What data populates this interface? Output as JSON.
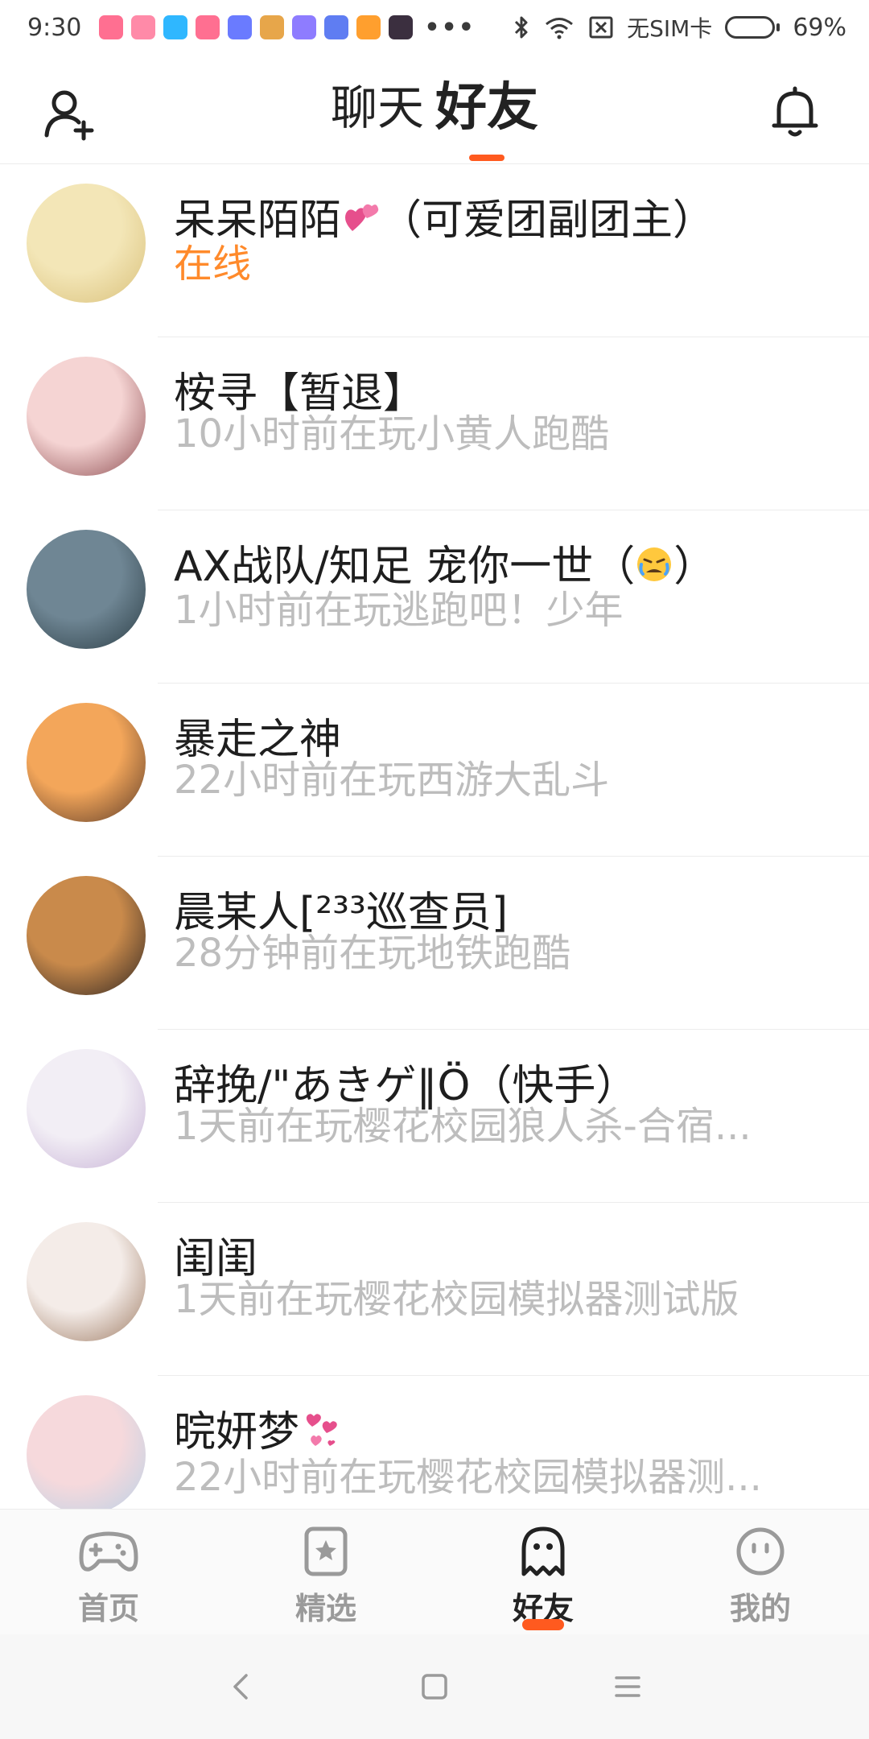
{
  "status_bar": {
    "time": "9:30",
    "more": "•••",
    "sim_status": "无SIM卡",
    "battery_percent": "69%",
    "battery_level": 0.69,
    "app_icon_colors": [
      "#ff6f91",
      "#ff8aa8",
      "#2fb7ff",
      "#ff6f91",
      "#6a7bff",
      "#e7a64a",
      "#8e7cff",
      "#5f7df2",
      "#ff9f2e",
      "#3b2f3f"
    ]
  },
  "header": {
    "tab_chat": "聊天",
    "tab_friends": "好友",
    "add_friend_icon": "add-user-icon",
    "notification_icon": "bell-icon",
    "accent_color": "#ff5a1f"
  },
  "friends": [
    {
      "name": "呆呆陌陌",
      "name_suffix": "（可爱团副团主）",
      "emoji": "two-hearts",
      "status": "在线",
      "online": true,
      "avatar_colors": [
        "#f3e6b7",
        "#d9c07a"
      ]
    },
    {
      "name": "桉寻【暂退】",
      "name_suffix": "",
      "emoji": "",
      "status": "10小时前在玩小黄人跑酷",
      "online": false,
      "avatar_colors": [
        "#f5d4d3",
        "#8c4b4f"
      ]
    },
    {
      "name": "AX战队/知足 宠你一世（",
      "name_suffix": "）",
      "emoji": "crying-face",
      "status": "1小时前在玩逃跑吧！少年",
      "online": false,
      "avatar_colors": [
        "#6f8694",
        "#2b3d45"
      ]
    },
    {
      "name": "暴走之神",
      "name_suffix": "",
      "emoji": "",
      "status": "22小时前在玩西游大乱斗",
      "online": false,
      "avatar_colors": [
        "#f3a65a",
        "#5a3a28"
      ]
    },
    {
      "name": "晨某人[²³³巡查员]",
      "name_suffix": "",
      "emoji": "",
      "status": "28分钟前在玩地铁跑酷",
      "online": false,
      "avatar_colors": [
        "#c98a4b",
        "#2d2421"
      ]
    },
    {
      "name": "辞挽/\"あきゲ‖Ö（快手）",
      "name_suffix": "",
      "emoji": "",
      "status": "1天前在玩樱花校园狼人杀-合宿...",
      "online": false,
      "avatar_colors": [
        "#f2eef5",
        "#c7b2d6"
      ]
    },
    {
      "name": "闺闺",
      "name_suffix": "",
      "emoji": "",
      "status": "1天前在玩樱花校园模拟器测试版",
      "online": false,
      "avatar_colors": [
        "#f4ece8",
        "#9d7a62"
      ]
    },
    {
      "name": "晥妍梦",
      "name_suffix": "",
      "emoji": "revolving-hearts",
      "status": "22小时前在玩樱花校园模拟器测...",
      "online": false,
      "avatar_colors": [
        "#f6d9dc",
        "#b9d1e6"
      ]
    }
  ],
  "bottom_nav": {
    "items": [
      {
        "label": "首页",
        "icon": "gamepad-icon",
        "active": false
      },
      {
        "label": "精选",
        "icon": "star-card-icon",
        "active": false
      },
      {
        "label": "好友",
        "icon": "ghost-icon",
        "active": true
      },
      {
        "label": "我的",
        "icon": "smiley-face-icon",
        "active": false
      }
    ]
  },
  "system_nav": {
    "back_icon": "back-chevron-icon",
    "home_icon": "home-square-icon",
    "menu_icon": "menu-lines-icon"
  }
}
